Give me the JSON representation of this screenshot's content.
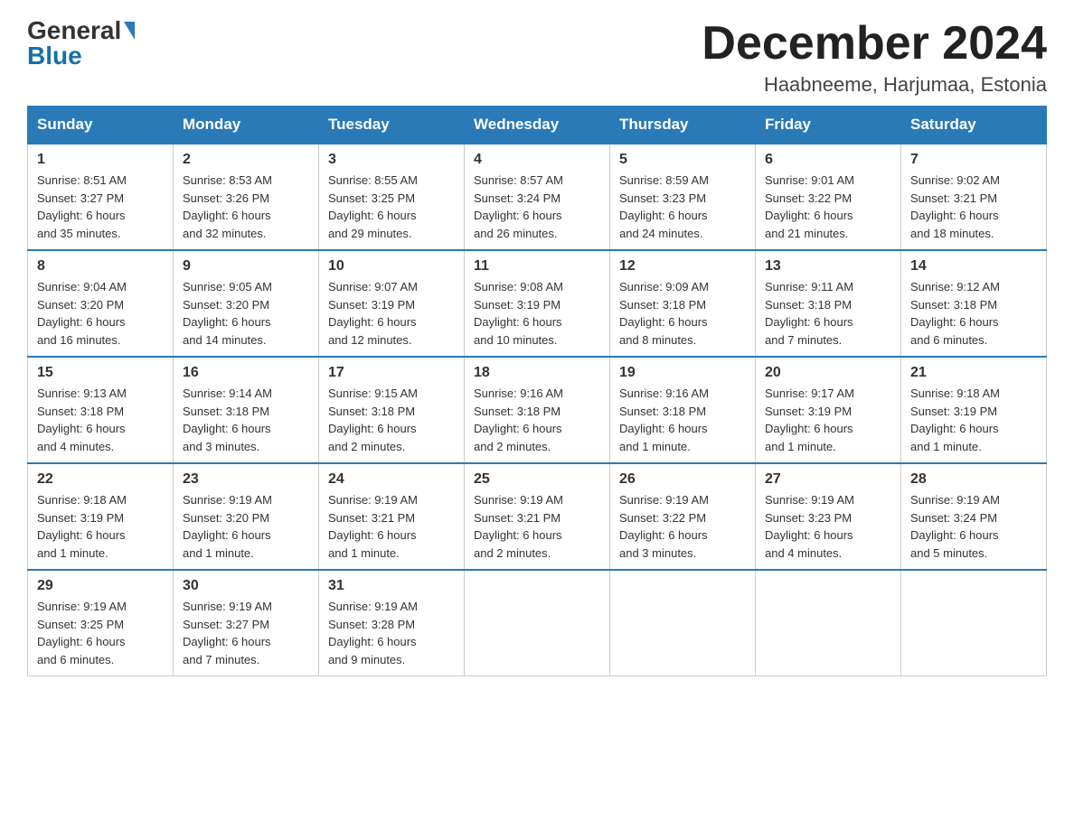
{
  "logo": {
    "general": "General",
    "blue": "Blue"
  },
  "title": {
    "month": "December 2024",
    "location": "Haabneeme, Harjumaa, Estonia"
  },
  "weekdays": [
    "Sunday",
    "Monday",
    "Tuesday",
    "Wednesday",
    "Thursday",
    "Friday",
    "Saturday"
  ],
  "weeks": [
    [
      {
        "day": "1",
        "sunrise": "Sunrise: 8:51 AM",
        "sunset": "Sunset: 3:27 PM",
        "daylight": "Daylight: 6 hours",
        "daylight2": "and 35 minutes."
      },
      {
        "day": "2",
        "sunrise": "Sunrise: 8:53 AM",
        "sunset": "Sunset: 3:26 PM",
        "daylight": "Daylight: 6 hours",
        "daylight2": "and 32 minutes."
      },
      {
        "day": "3",
        "sunrise": "Sunrise: 8:55 AM",
        "sunset": "Sunset: 3:25 PM",
        "daylight": "Daylight: 6 hours",
        "daylight2": "and 29 minutes."
      },
      {
        "day": "4",
        "sunrise": "Sunrise: 8:57 AM",
        "sunset": "Sunset: 3:24 PM",
        "daylight": "Daylight: 6 hours",
        "daylight2": "and 26 minutes."
      },
      {
        "day": "5",
        "sunrise": "Sunrise: 8:59 AM",
        "sunset": "Sunset: 3:23 PM",
        "daylight": "Daylight: 6 hours",
        "daylight2": "and 24 minutes."
      },
      {
        "day": "6",
        "sunrise": "Sunrise: 9:01 AM",
        "sunset": "Sunset: 3:22 PM",
        "daylight": "Daylight: 6 hours",
        "daylight2": "and 21 minutes."
      },
      {
        "day": "7",
        "sunrise": "Sunrise: 9:02 AM",
        "sunset": "Sunset: 3:21 PM",
        "daylight": "Daylight: 6 hours",
        "daylight2": "and 18 minutes."
      }
    ],
    [
      {
        "day": "8",
        "sunrise": "Sunrise: 9:04 AM",
        "sunset": "Sunset: 3:20 PM",
        "daylight": "Daylight: 6 hours",
        "daylight2": "and 16 minutes."
      },
      {
        "day": "9",
        "sunrise": "Sunrise: 9:05 AM",
        "sunset": "Sunset: 3:20 PM",
        "daylight": "Daylight: 6 hours",
        "daylight2": "and 14 minutes."
      },
      {
        "day": "10",
        "sunrise": "Sunrise: 9:07 AM",
        "sunset": "Sunset: 3:19 PM",
        "daylight": "Daylight: 6 hours",
        "daylight2": "and 12 minutes."
      },
      {
        "day": "11",
        "sunrise": "Sunrise: 9:08 AM",
        "sunset": "Sunset: 3:19 PM",
        "daylight": "Daylight: 6 hours",
        "daylight2": "and 10 minutes."
      },
      {
        "day": "12",
        "sunrise": "Sunrise: 9:09 AM",
        "sunset": "Sunset: 3:18 PM",
        "daylight": "Daylight: 6 hours",
        "daylight2": "and 8 minutes."
      },
      {
        "day": "13",
        "sunrise": "Sunrise: 9:11 AM",
        "sunset": "Sunset: 3:18 PM",
        "daylight": "Daylight: 6 hours",
        "daylight2": "and 7 minutes."
      },
      {
        "day": "14",
        "sunrise": "Sunrise: 9:12 AM",
        "sunset": "Sunset: 3:18 PM",
        "daylight": "Daylight: 6 hours",
        "daylight2": "and 6 minutes."
      }
    ],
    [
      {
        "day": "15",
        "sunrise": "Sunrise: 9:13 AM",
        "sunset": "Sunset: 3:18 PM",
        "daylight": "Daylight: 6 hours",
        "daylight2": "and 4 minutes."
      },
      {
        "day": "16",
        "sunrise": "Sunrise: 9:14 AM",
        "sunset": "Sunset: 3:18 PM",
        "daylight": "Daylight: 6 hours",
        "daylight2": "and 3 minutes."
      },
      {
        "day": "17",
        "sunrise": "Sunrise: 9:15 AM",
        "sunset": "Sunset: 3:18 PM",
        "daylight": "Daylight: 6 hours",
        "daylight2": "and 2 minutes."
      },
      {
        "day": "18",
        "sunrise": "Sunrise: 9:16 AM",
        "sunset": "Sunset: 3:18 PM",
        "daylight": "Daylight: 6 hours",
        "daylight2": "and 2 minutes."
      },
      {
        "day": "19",
        "sunrise": "Sunrise: 9:16 AM",
        "sunset": "Sunset: 3:18 PM",
        "daylight": "Daylight: 6 hours",
        "daylight2": "and 1 minute."
      },
      {
        "day": "20",
        "sunrise": "Sunrise: 9:17 AM",
        "sunset": "Sunset: 3:19 PM",
        "daylight": "Daylight: 6 hours",
        "daylight2": "and 1 minute."
      },
      {
        "day": "21",
        "sunrise": "Sunrise: 9:18 AM",
        "sunset": "Sunset: 3:19 PM",
        "daylight": "Daylight: 6 hours",
        "daylight2": "and 1 minute."
      }
    ],
    [
      {
        "day": "22",
        "sunrise": "Sunrise: 9:18 AM",
        "sunset": "Sunset: 3:19 PM",
        "daylight": "Daylight: 6 hours",
        "daylight2": "and 1 minute."
      },
      {
        "day": "23",
        "sunrise": "Sunrise: 9:19 AM",
        "sunset": "Sunset: 3:20 PM",
        "daylight": "Daylight: 6 hours",
        "daylight2": "and 1 minute."
      },
      {
        "day": "24",
        "sunrise": "Sunrise: 9:19 AM",
        "sunset": "Sunset: 3:21 PM",
        "daylight": "Daylight: 6 hours",
        "daylight2": "and 1 minute."
      },
      {
        "day": "25",
        "sunrise": "Sunrise: 9:19 AM",
        "sunset": "Sunset: 3:21 PM",
        "daylight": "Daylight: 6 hours",
        "daylight2": "and 2 minutes."
      },
      {
        "day": "26",
        "sunrise": "Sunrise: 9:19 AM",
        "sunset": "Sunset: 3:22 PM",
        "daylight": "Daylight: 6 hours",
        "daylight2": "and 3 minutes."
      },
      {
        "day": "27",
        "sunrise": "Sunrise: 9:19 AM",
        "sunset": "Sunset: 3:23 PM",
        "daylight": "Daylight: 6 hours",
        "daylight2": "and 4 minutes."
      },
      {
        "day": "28",
        "sunrise": "Sunrise: 9:19 AM",
        "sunset": "Sunset: 3:24 PM",
        "daylight": "Daylight: 6 hours",
        "daylight2": "and 5 minutes."
      }
    ],
    [
      {
        "day": "29",
        "sunrise": "Sunrise: 9:19 AM",
        "sunset": "Sunset: 3:25 PM",
        "daylight": "Daylight: 6 hours",
        "daylight2": "and 6 minutes."
      },
      {
        "day": "30",
        "sunrise": "Sunrise: 9:19 AM",
        "sunset": "Sunset: 3:27 PM",
        "daylight": "Daylight: 6 hours",
        "daylight2": "and 7 minutes."
      },
      {
        "day": "31",
        "sunrise": "Sunrise: 9:19 AM",
        "sunset": "Sunset: 3:28 PM",
        "daylight": "Daylight: 6 hours",
        "daylight2": "and 9 minutes."
      },
      null,
      null,
      null,
      null
    ]
  ]
}
